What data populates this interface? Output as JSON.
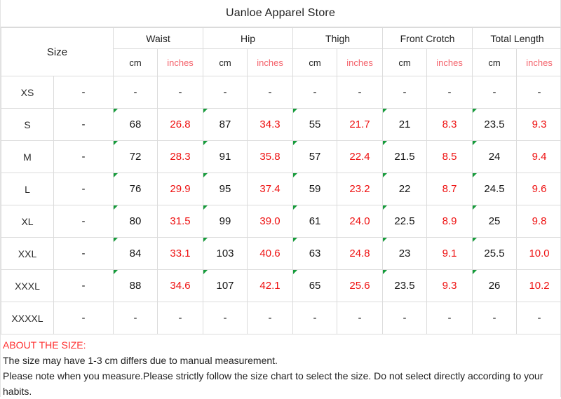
{
  "title": "Uanloe Apparel Store",
  "table": {
    "size_header": "Size",
    "groups": [
      {
        "label": "Waist"
      },
      {
        "label": "Hip"
      },
      {
        "label": "Thigh"
      },
      {
        "label": "Front Crotch"
      },
      {
        "label": "Total Length"
      }
    ],
    "units": {
      "cm": "cm",
      "inches": "inches"
    },
    "dash": "-",
    "rows": [
      {
        "size": "XS",
        "spacer": "-",
        "waist_cm": "-",
        "waist_in": "-",
        "hip_cm": "-",
        "hip_in": "-",
        "thigh_cm": "-",
        "thigh_in": "-",
        "crotch_cm": "-",
        "crotch_in": "-",
        "length_cm": "-",
        "length_in": "-",
        "flagged": false
      },
      {
        "size": "S",
        "spacer": "-",
        "waist_cm": "68",
        "waist_in": "26.8",
        "hip_cm": "87",
        "hip_in": "34.3",
        "thigh_cm": "55",
        "thigh_in": "21.7",
        "crotch_cm": "21",
        "crotch_in": "8.3",
        "length_cm": "23.5",
        "length_in": "9.3",
        "flagged": true
      },
      {
        "size": "M",
        "spacer": "-",
        "waist_cm": "72",
        "waist_in": "28.3",
        "hip_cm": "91",
        "hip_in": "35.8",
        "thigh_cm": "57",
        "thigh_in": "22.4",
        "crotch_cm": "21.5",
        "crotch_in": "8.5",
        "length_cm": "24",
        "length_in": "9.4",
        "flagged": true
      },
      {
        "size": "L",
        "spacer": "-",
        "waist_cm": "76",
        "waist_in": "29.9",
        "hip_cm": "95",
        "hip_in": "37.4",
        "thigh_cm": "59",
        "thigh_in": "23.2",
        "crotch_cm": "22",
        "crotch_in": "8.7",
        "length_cm": "24.5",
        "length_in": "9.6",
        "flagged": true
      },
      {
        "size": "XL",
        "spacer": "-",
        "waist_cm": "80",
        "waist_in": "31.5",
        "hip_cm": "99",
        "hip_in": "39.0",
        "thigh_cm": "61",
        "thigh_in": "24.0",
        "crotch_cm": "22.5",
        "crotch_in": "8.9",
        "length_cm": "25",
        "length_in": "9.8",
        "flagged": true
      },
      {
        "size": "XXL",
        "spacer": "-",
        "waist_cm": "84",
        "waist_in": "33.1",
        "hip_cm": "103",
        "hip_in": "40.6",
        "thigh_cm": "63",
        "thigh_in": "24.8",
        "crotch_cm": "23",
        "crotch_in": "9.1",
        "length_cm": "25.5",
        "length_in": "10.0",
        "flagged": true
      },
      {
        "size": "XXXL",
        "spacer": "-",
        "waist_cm": "88",
        "waist_in": "34.6",
        "hip_cm": "107",
        "hip_in": "42.1",
        "thigh_cm": "65",
        "thigh_in": "25.6",
        "crotch_cm": "23.5",
        "crotch_in": "9.3",
        "length_cm": "26",
        "length_in": "10.2",
        "flagged": true
      },
      {
        "size": "XXXXL",
        "spacer": "-",
        "waist_cm": "-",
        "waist_in": "-",
        "hip_cm": "-",
        "hip_in": "-",
        "thigh_cm": "-",
        "thigh_in": "-",
        "crotch_cm": "-",
        "crotch_in": "-",
        "length_cm": "-",
        "length_in": "-",
        "flagged": false
      }
    ]
  },
  "notes": {
    "heading": "ABOUT THE SIZE:",
    "line1": "The size may have 1-3 cm differs due to manual measurement.",
    "line2": "Please note when you measure.Please strictly follow the size chart  to select the size. Do not select directly according to your",
    "line3": "habits."
  },
  "colors": {
    "inches_header": "#f4616a",
    "inches_value": "#ee1111",
    "note_heading": "#ff2d2d",
    "flag_green": "#169b3b",
    "grid": "#dcdcdc"
  }
}
